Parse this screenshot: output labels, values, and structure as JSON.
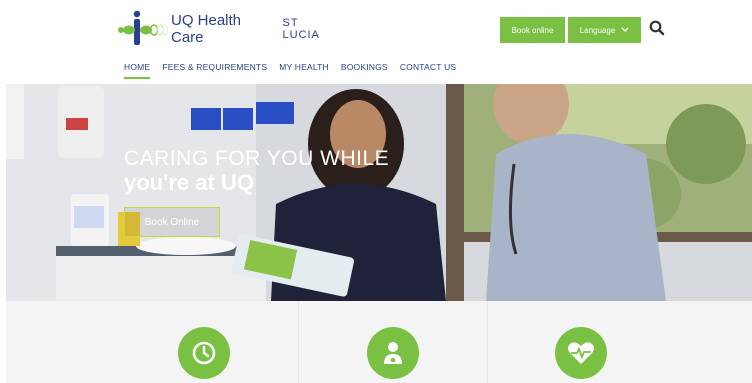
{
  "brand": {
    "name": "UQ Health Care",
    "campus": "ST LUCIA",
    "color_primary": "#2a3f8f",
    "color_accent": "#7ac143"
  },
  "header": {
    "book_online_label": "Book online",
    "language_label": "Language",
    "search_icon": "search-icon"
  },
  "nav": {
    "items": [
      {
        "label": "HOME",
        "active": true
      },
      {
        "label": "FEES & REQUIREMENTS",
        "active": false
      },
      {
        "label": "MY HEALTH",
        "active": false
      },
      {
        "label": "BOOKINGS",
        "active": false
      },
      {
        "label": "CONTACT US",
        "active": false
      }
    ]
  },
  "hero": {
    "line1": "CARING FOR YOU WHILE",
    "line2": "you're at UQ",
    "button_label": "Book Online"
  },
  "features": {
    "icons": [
      "clock-icon",
      "doctor-icon",
      "heartbeat-icon"
    ]
  }
}
